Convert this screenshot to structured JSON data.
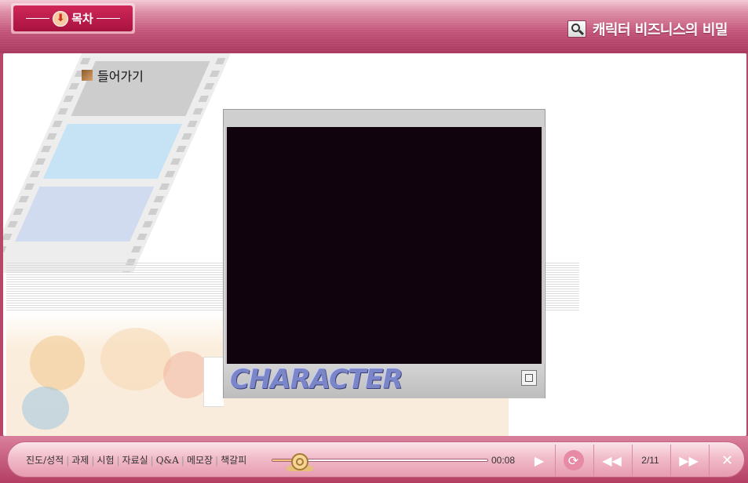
{
  "header": {
    "toc_label": "목차",
    "title": "캐릭터 비즈니스의 비밀"
  },
  "content": {
    "enter_label": "들어가기",
    "player_logo": "CHARACTER"
  },
  "controls": {
    "menu": [
      "진도/성적",
      "과제",
      "시험",
      "자료실",
      "Q&A",
      "메모장",
      "책갈피"
    ],
    "time": "00:08",
    "page": "2/11"
  }
}
